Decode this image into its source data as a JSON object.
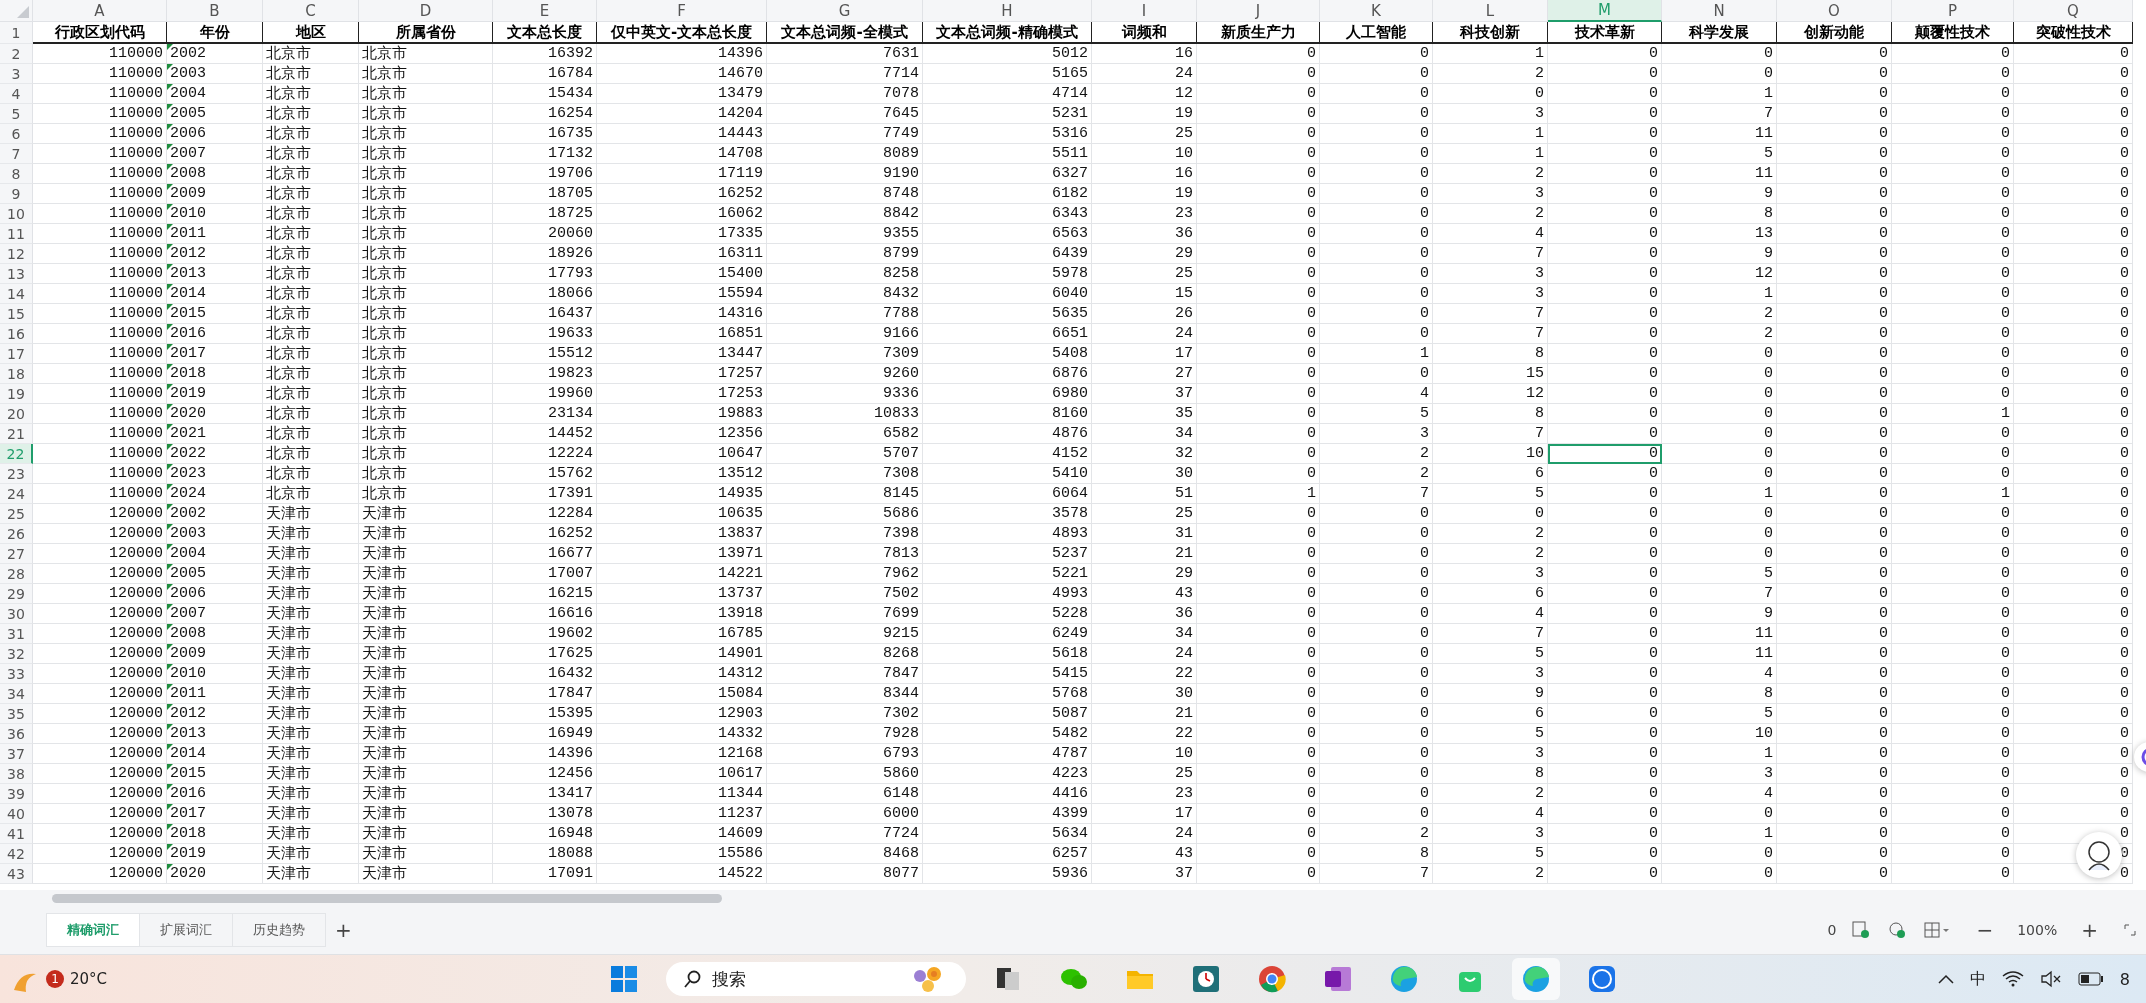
{
  "columns": [
    {
      "letter": "A",
      "kind": "number",
      "selected": false,
      "text_flag": false
    },
    {
      "letter": "B",
      "kind": "text",
      "selected": false,
      "text_flag": true
    },
    {
      "letter": "C",
      "kind": "text",
      "selected": false,
      "text_flag": false
    },
    {
      "letter": "D",
      "kind": "text",
      "selected": false,
      "text_flag": false
    },
    {
      "letter": "E",
      "kind": "number",
      "selected": false,
      "text_flag": false
    },
    {
      "letter": "F",
      "kind": "number",
      "selected": false,
      "text_flag": false
    },
    {
      "letter": "G",
      "kind": "number",
      "selected": false,
      "text_flag": false
    },
    {
      "letter": "H",
      "kind": "number",
      "selected": false,
      "text_flag": false
    },
    {
      "letter": "I",
      "kind": "number",
      "selected": false,
      "text_flag": false
    },
    {
      "letter": "J",
      "kind": "number",
      "selected": false,
      "text_flag": false
    },
    {
      "letter": "K",
      "kind": "number",
      "selected": false,
      "text_flag": false
    },
    {
      "letter": "L",
      "kind": "number",
      "selected": false,
      "text_flag": false
    },
    {
      "letter": "M",
      "kind": "number",
      "selected": true,
      "text_flag": false
    },
    {
      "letter": "N",
      "kind": "number",
      "selected": false,
      "text_flag": false
    },
    {
      "letter": "O",
      "kind": "number",
      "selected": false,
      "text_flag": false
    },
    {
      "letter": "P",
      "kind": "number",
      "selected": false,
      "text_flag": false
    },
    {
      "letter": "Q",
      "kind": "number",
      "selected": false,
      "text_flag": false
    }
  ],
  "header": {
    "row": "1",
    "cells": [
      "行政区划代码",
      "年份",
      "地区",
      "所属省份",
      "文本总长度",
      "仅中英文-文本总长度",
      "文本总词频-全模式",
      "文本总词频-精确模式",
      "词频和",
      "新质生产力",
      "人工智能",
      "科技创新",
      "技术革新",
      "科学发展",
      "创新动能",
      "颠覆性技术",
      "突破性技术"
    ]
  },
  "rows": [
    {
      "row": "2",
      "selected": false,
      "cells": [
        "110000",
        "2002",
        "北京市",
        "北京市",
        "16392",
        "14396",
        "7631",
        "5012",
        "16",
        "0",
        "0",
        "1",
        "0",
        "0",
        "0",
        "0",
        "0"
      ]
    },
    {
      "row": "3",
      "selected": false,
      "cells": [
        "110000",
        "2003",
        "北京市",
        "北京市",
        "16784",
        "14670",
        "7714",
        "5165",
        "24",
        "0",
        "0",
        "2",
        "0",
        "0",
        "0",
        "0",
        "0"
      ]
    },
    {
      "row": "4",
      "selected": false,
      "cells": [
        "110000",
        "2004",
        "北京市",
        "北京市",
        "15434",
        "13479",
        "7078",
        "4714",
        "12",
        "0",
        "0",
        "0",
        "0",
        "1",
        "0",
        "0",
        "0"
      ]
    },
    {
      "row": "5",
      "selected": false,
      "cells": [
        "110000",
        "2005",
        "北京市",
        "北京市",
        "16254",
        "14204",
        "7645",
        "5231",
        "19",
        "0",
        "0",
        "3",
        "0",
        "7",
        "0",
        "0",
        "0"
      ]
    },
    {
      "row": "6",
      "selected": false,
      "cells": [
        "110000",
        "2006",
        "北京市",
        "北京市",
        "16735",
        "14443",
        "7749",
        "5316",
        "25",
        "0",
        "0",
        "1",
        "0",
        "11",
        "0",
        "0",
        "0"
      ]
    },
    {
      "row": "7",
      "selected": false,
      "cells": [
        "110000",
        "2007",
        "北京市",
        "北京市",
        "17132",
        "14708",
        "8089",
        "5511",
        "10",
        "0",
        "0",
        "1",
        "0",
        "5",
        "0",
        "0",
        "0"
      ]
    },
    {
      "row": "8",
      "selected": false,
      "cells": [
        "110000",
        "2008",
        "北京市",
        "北京市",
        "19706",
        "17119",
        "9190",
        "6327",
        "16",
        "0",
        "0",
        "2",
        "0",
        "11",
        "0",
        "0",
        "0"
      ]
    },
    {
      "row": "9",
      "selected": false,
      "cells": [
        "110000",
        "2009",
        "北京市",
        "北京市",
        "18705",
        "16252",
        "8748",
        "6182",
        "19",
        "0",
        "0",
        "3",
        "0",
        "9",
        "0",
        "0",
        "0"
      ]
    },
    {
      "row": "10",
      "selected": false,
      "cells": [
        "110000",
        "2010",
        "北京市",
        "北京市",
        "18725",
        "16062",
        "8842",
        "6343",
        "23",
        "0",
        "0",
        "2",
        "0",
        "8",
        "0",
        "0",
        "0"
      ]
    },
    {
      "row": "11",
      "selected": false,
      "cells": [
        "110000",
        "2011",
        "北京市",
        "北京市",
        "20060",
        "17335",
        "9355",
        "6563",
        "36",
        "0",
        "0",
        "4",
        "0",
        "13",
        "0",
        "0",
        "0"
      ]
    },
    {
      "row": "12",
      "selected": false,
      "cells": [
        "110000",
        "2012",
        "北京市",
        "北京市",
        "18926",
        "16311",
        "8799",
        "6439",
        "29",
        "0",
        "0",
        "7",
        "0",
        "9",
        "0",
        "0",
        "0"
      ]
    },
    {
      "row": "13",
      "selected": false,
      "cells": [
        "110000",
        "2013",
        "北京市",
        "北京市",
        "17793",
        "15400",
        "8258",
        "5978",
        "25",
        "0",
        "0",
        "3",
        "0",
        "12",
        "0",
        "0",
        "0"
      ]
    },
    {
      "row": "14",
      "selected": false,
      "cells": [
        "110000",
        "2014",
        "北京市",
        "北京市",
        "18066",
        "15594",
        "8432",
        "6040",
        "15",
        "0",
        "0",
        "3",
        "0",
        "1",
        "0",
        "0",
        "0"
      ]
    },
    {
      "row": "15",
      "selected": false,
      "cells": [
        "110000",
        "2015",
        "北京市",
        "北京市",
        "16437",
        "14316",
        "7788",
        "5635",
        "26",
        "0",
        "0",
        "7",
        "0",
        "2",
        "0",
        "0",
        "0"
      ]
    },
    {
      "row": "16",
      "selected": false,
      "cells": [
        "110000",
        "2016",
        "北京市",
        "北京市",
        "19633",
        "16851",
        "9166",
        "6651",
        "24",
        "0",
        "0",
        "7",
        "0",
        "2",
        "0",
        "0",
        "0"
      ]
    },
    {
      "row": "17",
      "selected": false,
      "cells": [
        "110000",
        "2017",
        "北京市",
        "北京市",
        "15512",
        "13447",
        "7309",
        "5408",
        "17",
        "0",
        "1",
        "8",
        "0",
        "0",
        "0",
        "0",
        "0"
      ]
    },
    {
      "row": "18",
      "selected": false,
      "cells": [
        "110000",
        "2018",
        "北京市",
        "北京市",
        "19823",
        "17257",
        "9260",
        "6876",
        "27",
        "0",
        "0",
        "15",
        "0",
        "0",
        "0",
        "0",
        "0"
      ]
    },
    {
      "row": "19",
      "selected": false,
      "cells": [
        "110000",
        "2019",
        "北京市",
        "北京市",
        "19960",
        "17253",
        "9336",
        "6980",
        "37",
        "0",
        "4",
        "12",
        "0",
        "0",
        "0",
        "0",
        "0"
      ]
    },
    {
      "row": "20",
      "selected": false,
      "cells": [
        "110000",
        "2020",
        "北京市",
        "北京市",
        "23134",
        "19883",
        "10833",
        "8160",
        "35",
        "0",
        "5",
        "8",
        "0",
        "0",
        "0",
        "1",
        "0"
      ]
    },
    {
      "row": "21",
      "selected": false,
      "cells": [
        "110000",
        "2021",
        "北京市",
        "北京市",
        "14452",
        "12356",
        "6582",
        "4876",
        "34",
        "0",
        "3",
        "7",
        "0",
        "0",
        "0",
        "0",
        "0"
      ]
    },
    {
      "row": "22",
      "selected": true,
      "cells": [
        "110000",
        "2022",
        "北京市",
        "北京市",
        "12224",
        "10647",
        "5707",
        "4152",
        "32",
        "0",
        "2",
        "10",
        "0",
        "0",
        "0",
        "0",
        "0"
      ]
    },
    {
      "row": "23",
      "selected": false,
      "cells": [
        "110000",
        "2023",
        "北京市",
        "北京市",
        "15762",
        "13512",
        "7308",
        "5410",
        "30",
        "0",
        "2",
        "6",
        "0",
        "0",
        "0",
        "0",
        "0"
      ]
    },
    {
      "row": "24",
      "selected": false,
      "cells": [
        "110000",
        "2024",
        "北京市",
        "北京市",
        "17391",
        "14935",
        "8145",
        "6064",
        "51",
        "1",
        "7",
        "5",
        "0",
        "1",
        "0",
        "1",
        "0"
      ]
    },
    {
      "row": "25",
      "selected": false,
      "cells": [
        "120000",
        "2002",
        "天津市",
        "天津市",
        "12284",
        "10635",
        "5686",
        "3578",
        "25",
        "0",
        "0",
        "0",
        "0",
        "0",
        "0",
        "0",
        "0"
      ]
    },
    {
      "row": "26",
      "selected": false,
      "cells": [
        "120000",
        "2003",
        "天津市",
        "天津市",
        "16252",
        "13837",
        "7398",
        "4893",
        "31",
        "0",
        "0",
        "2",
        "0",
        "0",
        "0",
        "0",
        "0"
      ]
    },
    {
      "row": "27",
      "selected": false,
      "cells": [
        "120000",
        "2004",
        "天津市",
        "天津市",
        "16677",
        "13971",
        "7813",
        "5237",
        "21",
        "0",
        "0",
        "2",
        "0",
        "0",
        "0",
        "0",
        "0"
      ]
    },
    {
      "row": "28",
      "selected": false,
      "cells": [
        "120000",
        "2005",
        "天津市",
        "天津市",
        "17007",
        "14221",
        "7962",
        "5221",
        "29",
        "0",
        "0",
        "3",
        "0",
        "5",
        "0",
        "0",
        "0"
      ]
    },
    {
      "row": "29",
      "selected": false,
      "cells": [
        "120000",
        "2006",
        "天津市",
        "天津市",
        "16215",
        "13737",
        "7502",
        "4993",
        "43",
        "0",
        "0",
        "6",
        "0",
        "7",
        "0",
        "0",
        "0"
      ]
    },
    {
      "row": "30",
      "selected": false,
      "cells": [
        "120000",
        "2007",
        "天津市",
        "天津市",
        "16616",
        "13918",
        "7699",
        "5228",
        "36",
        "0",
        "0",
        "4",
        "0",
        "9",
        "0",
        "0",
        "0"
      ]
    },
    {
      "row": "31",
      "selected": false,
      "cells": [
        "120000",
        "2008",
        "天津市",
        "天津市",
        "19602",
        "16785",
        "9215",
        "6249",
        "34",
        "0",
        "0",
        "7",
        "0",
        "11",
        "0",
        "0",
        "0"
      ]
    },
    {
      "row": "32",
      "selected": false,
      "cells": [
        "120000",
        "2009",
        "天津市",
        "天津市",
        "17625",
        "14901",
        "8268",
        "5618",
        "24",
        "0",
        "0",
        "5",
        "0",
        "11",
        "0",
        "0",
        "0"
      ]
    },
    {
      "row": "33",
      "selected": false,
      "cells": [
        "120000",
        "2010",
        "天津市",
        "天津市",
        "16432",
        "14312",
        "7847",
        "5415",
        "22",
        "0",
        "0",
        "3",
        "0",
        "4",
        "0",
        "0",
        "0"
      ]
    },
    {
      "row": "34",
      "selected": false,
      "cells": [
        "120000",
        "2011",
        "天津市",
        "天津市",
        "17847",
        "15084",
        "8344",
        "5768",
        "30",
        "0",
        "0",
        "9",
        "0",
        "8",
        "0",
        "0",
        "0"
      ]
    },
    {
      "row": "35",
      "selected": false,
      "cells": [
        "120000",
        "2012",
        "天津市",
        "天津市",
        "15395",
        "12903",
        "7302",
        "5087",
        "21",
        "0",
        "0",
        "6",
        "0",
        "5",
        "0",
        "0",
        "0"
      ]
    },
    {
      "row": "36",
      "selected": false,
      "cells": [
        "120000",
        "2013",
        "天津市",
        "天津市",
        "16949",
        "14332",
        "7928",
        "5482",
        "22",
        "0",
        "0",
        "5",
        "0",
        "10",
        "0",
        "0",
        "0"
      ]
    },
    {
      "row": "37",
      "selected": false,
      "cells": [
        "120000",
        "2014",
        "天津市",
        "天津市",
        "14396",
        "12168",
        "6793",
        "4787",
        "10",
        "0",
        "0",
        "3",
        "0",
        "1",
        "0",
        "0",
        "0"
      ]
    },
    {
      "row": "38",
      "selected": false,
      "cells": [
        "120000",
        "2015",
        "天津市",
        "天津市",
        "12456",
        "10617",
        "5860",
        "4223",
        "25",
        "0",
        "0",
        "8",
        "0",
        "3",
        "0",
        "0",
        "0"
      ]
    },
    {
      "row": "39",
      "selected": false,
      "cells": [
        "120000",
        "2016",
        "天津市",
        "天津市",
        "13417",
        "11344",
        "6148",
        "4416",
        "23",
        "0",
        "0",
        "2",
        "0",
        "4",
        "0",
        "0",
        "0"
      ]
    },
    {
      "row": "40",
      "selected": false,
      "cells": [
        "120000",
        "2017",
        "天津市",
        "天津市",
        "13078",
        "11237",
        "6000",
        "4399",
        "17",
        "0",
        "0",
        "4",
        "0",
        "0",
        "0",
        "0",
        "0"
      ]
    },
    {
      "row": "41",
      "selected": false,
      "cells": [
        "120000",
        "2018",
        "天津市",
        "天津市",
        "16948",
        "14609",
        "7724",
        "5634",
        "24",
        "0",
        "2",
        "3",
        "0",
        "1",
        "0",
        "0",
        "0"
      ]
    },
    {
      "row": "42",
      "selected": false,
      "cells": [
        "120000",
        "2019",
        "天津市",
        "天津市",
        "18088",
        "15586",
        "8468",
        "6257",
        "43",
        "0",
        "8",
        "5",
        "0",
        "0",
        "0",
        "0",
        "0"
      ]
    },
    {
      "row": "43",
      "selected": false,
      "cells": [
        "120000",
        "2020",
        "天津市",
        "天津市",
        "17091",
        "14522",
        "8077",
        "5936",
        "37",
        "0",
        "7",
        "2",
        "0",
        "0",
        "0",
        "0",
        "0"
      ]
    }
  ],
  "sheet_tabs": [
    {
      "label": "精确词汇",
      "selected": true
    },
    {
      "label": "扩展词汇",
      "selected": false
    },
    {
      "label": "历史趋势",
      "selected": false
    }
  ],
  "add_sheet": "+",
  "status_bar": {
    "count": "0",
    "zoom_out": "−",
    "zoom": "100%",
    "zoom_in": "+"
  },
  "taskbar": {
    "weather_badge": "1",
    "temperature": "20°C",
    "search_label": "搜索",
    "ime": "中",
    "clock": "8"
  }
}
